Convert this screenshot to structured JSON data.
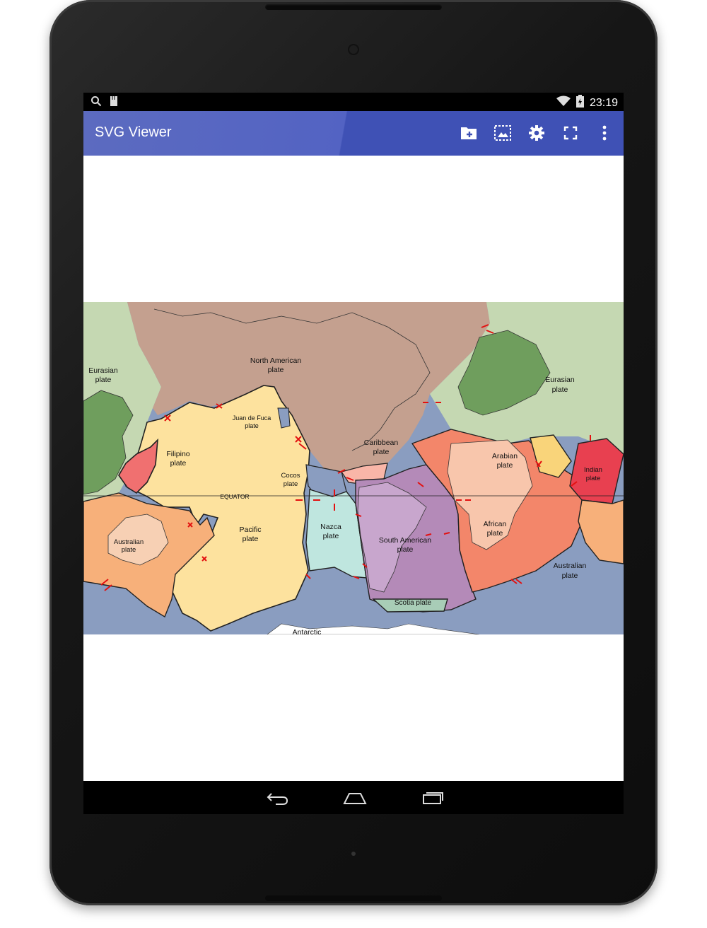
{
  "status_bar": {
    "time": "23:19",
    "icons": [
      "search-icon",
      "sd-card-icon",
      "wifi-icon",
      "battery-icon"
    ]
  },
  "app_bar": {
    "title": "SVG Viewer",
    "actions": [
      "open-folder-icon",
      "image-select-icon",
      "settings-icon",
      "fullscreen-icon",
      "overflow-menu-icon"
    ]
  },
  "map": {
    "labels": {
      "eurasian_left": [
        "Eurasian",
        "plate"
      ],
      "north_american": [
        "North American",
        "plate"
      ],
      "juan_de_fuca": [
        "Juan de Fuca",
        "plate"
      ],
      "filipino": [
        "Filipino",
        "plate"
      ],
      "caribbean": [
        "Caribbean",
        "plate"
      ],
      "cocos": [
        "Cocos",
        "plate"
      ],
      "equator": "EQUATOR",
      "eurasian_right": [
        "Eurasian",
        "plate"
      ],
      "arabian": [
        "Arabian",
        "plate"
      ],
      "indian": [
        "Indian",
        "plate"
      ],
      "australian_left": [
        "Australian",
        "plate"
      ],
      "pacific": [
        "Pacific",
        "plate"
      ],
      "nazca": [
        "Nazca",
        "plate"
      ],
      "south_american": [
        "South American",
        "plate"
      ],
      "african": [
        "African",
        "plate"
      ],
      "australian_right": [
        "Australian",
        "plate"
      ],
      "scotia": "Scotia plate",
      "antarctic": "Antarctic"
    },
    "colors": {
      "north_american": "#c4a08f",
      "pacific": "#fde29e",
      "eurasian": "#c5d8b2",
      "eurasian_dark": "#6f9e5d",
      "filipino": "#f07070",
      "australian": "#f7b07a",
      "antarctic": "#8a9dc0",
      "nazca": "#bfe6df",
      "south_american": "#b48ab8",
      "african": "#f3866a",
      "arabian": "#f9d47a",
      "indian": "#e84050",
      "scotia": "#a8cdb7",
      "caribbean": "#f9b6a8"
    }
  },
  "fab": {
    "icon": "add-icon"
  },
  "nav_bar": {
    "buttons": [
      "back-icon",
      "home-icon",
      "recents-icon"
    ]
  }
}
